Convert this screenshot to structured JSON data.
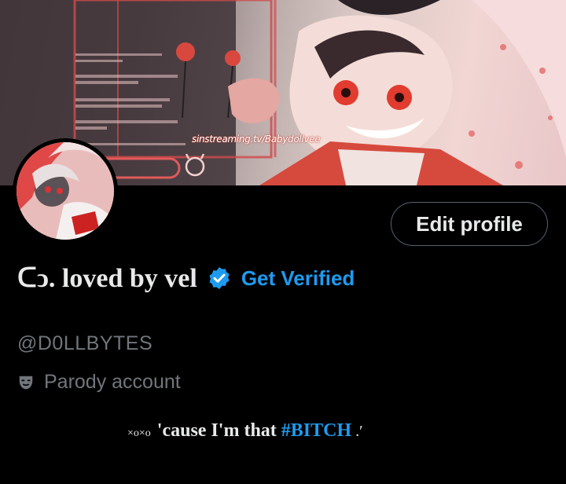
{
  "banner": {
    "watermark": "sinstreaming.tv/Babydollvee",
    "icon": "devil-smiley-icon"
  },
  "profile": {
    "avatar_icon": "profile-avatar",
    "edit_label": "Edit profile",
    "display_name": "ᑕↄ. loved by vel",
    "verified_icon": "verified-badge-icon",
    "get_verified_label": "Get Verified",
    "handle": "@D0LLBYTES",
    "parody_icon": "theater-mask-icon",
    "parody_label": "Parody account"
  },
  "bio": {
    "prefix": "×o×o",
    "text_before": "'cause I'm that ",
    "hashtag": "#BITCH",
    "text_after": " .′"
  },
  "colors": {
    "accent": "#1d9bf0",
    "secondary_text": "#71767b",
    "background": "#000000"
  }
}
